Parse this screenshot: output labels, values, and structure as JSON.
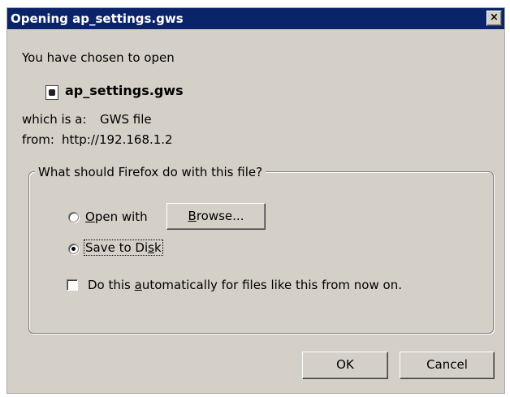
{
  "window": {
    "title": "Opening ap_settings.gws",
    "close_glyph": "×"
  },
  "intro": "You have chosen to open",
  "file": {
    "name": "ap_settings.gws",
    "icon": "file-icon",
    "type_label": "which is a:",
    "type_value": "GWS file",
    "from_label": "from:",
    "from_value": "http://192.168.1.2"
  },
  "group": {
    "legend": "What should Firefox do with this file?",
    "open_with": {
      "label": "Open with",
      "selected": false
    },
    "browse_button": "Browse...",
    "save_to_disk": {
      "label": "Save to Disk",
      "selected": true
    },
    "auto_checkbox": {
      "label": "Do this automatically for files like this from now on.",
      "checked": false
    }
  },
  "buttons": {
    "ok": "OK",
    "cancel": "Cancel"
  },
  "colors": {
    "titlebar": "#0a246a",
    "dialog_bg": "#d4d0c8"
  }
}
